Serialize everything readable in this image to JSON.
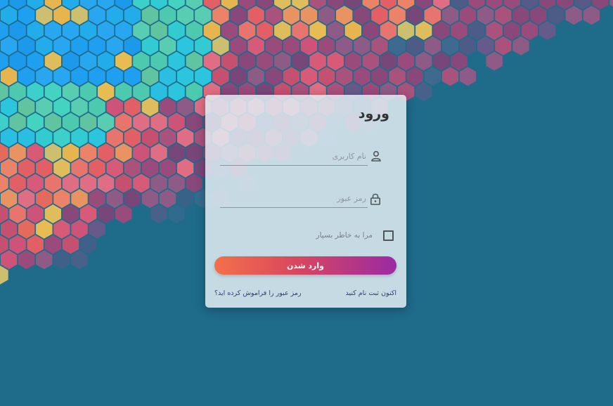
{
  "login": {
    "title": "ورود",
    "username_placeholder": "نام کاربری",
    "password_placeholder": "رمز عبور",
    "username_value": "",
    "password_value": "",
    "remember_label": "مرا به خاطر بسپار",
    "remember_checked": false,
    "submit_label": "وارد شدن",
    "register_link": "اکنون ثبت نام کنید",
    "forgot_link": "رمز عبور را فراموش کرده اید؟"
  },
  "icons": {
    "username": "user-icon",
    "password": "lock-icon"
  },
  "colors": {
    "background": "#1e6b8a",
    "card": "#e2ecf3",
    "button_start": "#f3704a",
    "button_end": "#9b2aa3",
    "link": "#2b3c7a"
  }
}
